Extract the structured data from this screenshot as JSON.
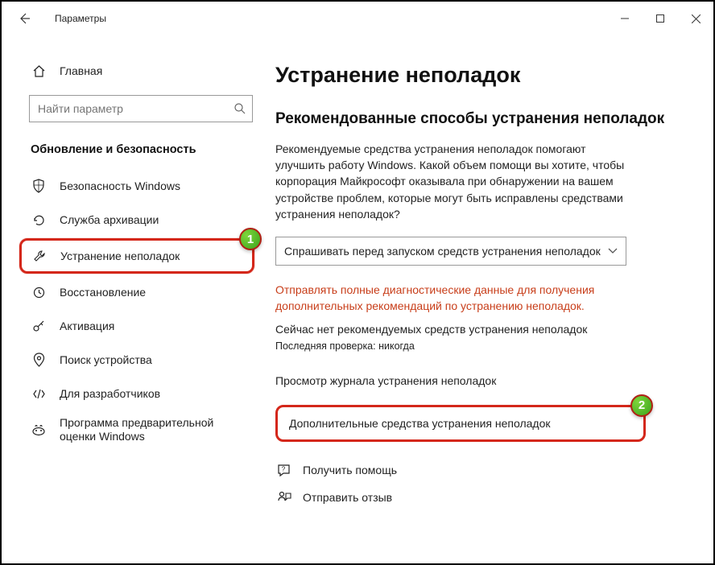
{
  "window": {
    "title": "Параметры"
  },
  "sidebar": {
    "home_label": "Главная",
    "search_placeholder": "Найти параметр",
    "section": "Обновление и безопасность",
    "items": [
      {
        "label": "Безопасность Windows"
      },
      {
        "label": "Служба архивации"
      },
      {
        "label": "Устранение неполадок"
      },
      {
        "label": "Восстановление"
      },
      {
        "label": "Активация"
      },
      {
        "label": "Поиск устройства"
      },
      {
        "label": "Для разработчиков"
      },
      {
        "label": "Программа предварительной оценки Windows"
      }
    ]
  },
  "main": {
    "title": "Устранение неполадок",
    "subtitle": "Рекомендованные способы устранения неполадок",
    "body": "Рекомендуемые средства устранения неполадок помогают улучшить работу Windows. Какой объем помощи вы хотите, чтобы корпорация Майкрософт оказывала при обнаружении на вашем устройстве проблем, которые могут быть исправлены средствами устранения неполадок?",
    "select_value": "Спрашивать перед запуском средств устранения неполадок",
    "notice": "Отправлять полные диагностические данные для получения дополнительных рекомендаций по устранению неполадок.",
    "status": "Сейчас нет рекомендуемых средств устранения неполадок",
    "last_check": "Последняя проверка: никогда",
    "history_link": "Просмотр журнала устранения неполадок",
    "additional_link": "Дополнительные средства устранения неполадок",
    "help_link": "Получить помощь",
    "feedback_link": "Отправить отзыв"
  },
  "callouts": {
    "one": "1",
    "two": "2"
  }
}
